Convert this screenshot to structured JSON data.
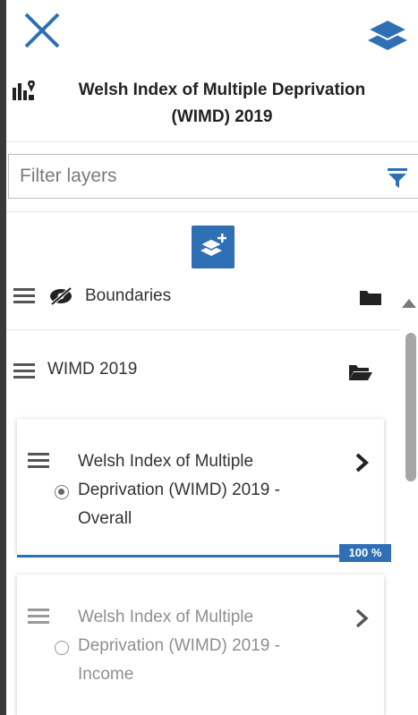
{
  "header": {
    "close_icon": "close-icon",
    "layers_icon": "layers-icon",
    "title_icon": "map-legend-icon",
    "title_line1": "Welsh Index of Multiple Deprivation",
    "title_line2": "(WIMD) 2019"
  },
  "filter": {
    "placeholder": "Filter layers",
    "value": "",
    "icon": "filter-icon"
  },
  "add_layer": {
    "icon": "add-layer-icon"
  },
  "groups": [
    {
      "label": "Boundaries",
      "visible": false,
      "folder_state": "closed"
    },
    {
      "label": "WIMD 2019",
      "folder_state": "open"
    }
  ],
  "layers": [
    {
      "line1": "Welsh Index of Multiple",
      "line2": "Deprivation (WIMD) 2019 -",
      "line3": "Overall",
      "selected": true,
      "progress_label": "100 %",
      "progress": 1.0
    },
    {
      "line1": "Welsh Index of Multiple",
      "line2": "Deprivation (WIMD) 2019 -",
      "line3": "Income",
      "selected": false
    }
  ],
  "colors": {
    "accent": "#2f70b5",
    "text": "#333333",
    "muted_text": "#8f8f8f"
  }
}
